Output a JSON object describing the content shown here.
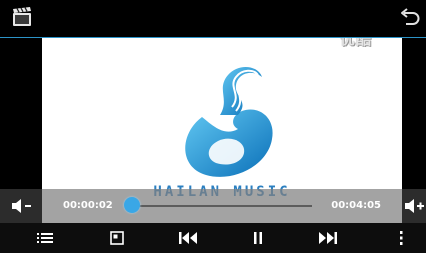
{
  "player": {
    "watermark": "优酷",
    "brand": "HAILAN MUSIC",
    "current_time": "00:00:02",
    "total_time": "00:04:05",
    "progress": 0.01
  },
  "icons": {
    "app": "video-clapper-icon",
    "back": "back-arrow-icon",
    "volume_down": "volume-down-icon",
    "volume_up": "volume-up-icon",
    "playlist": "playlist-icon",
    "screen_mode": "screen-mode-icon",
    "previous": "previous-track-icon",
    "pause": "pause-icon",
    "next": "next-track-icon",
    "more": "more-vertical-icon"
  },
  "colors": {
    "accent": "#2a9ee6",
    "brand": "#2b7fc0",
    "overlay": "#808080"
  }
}
